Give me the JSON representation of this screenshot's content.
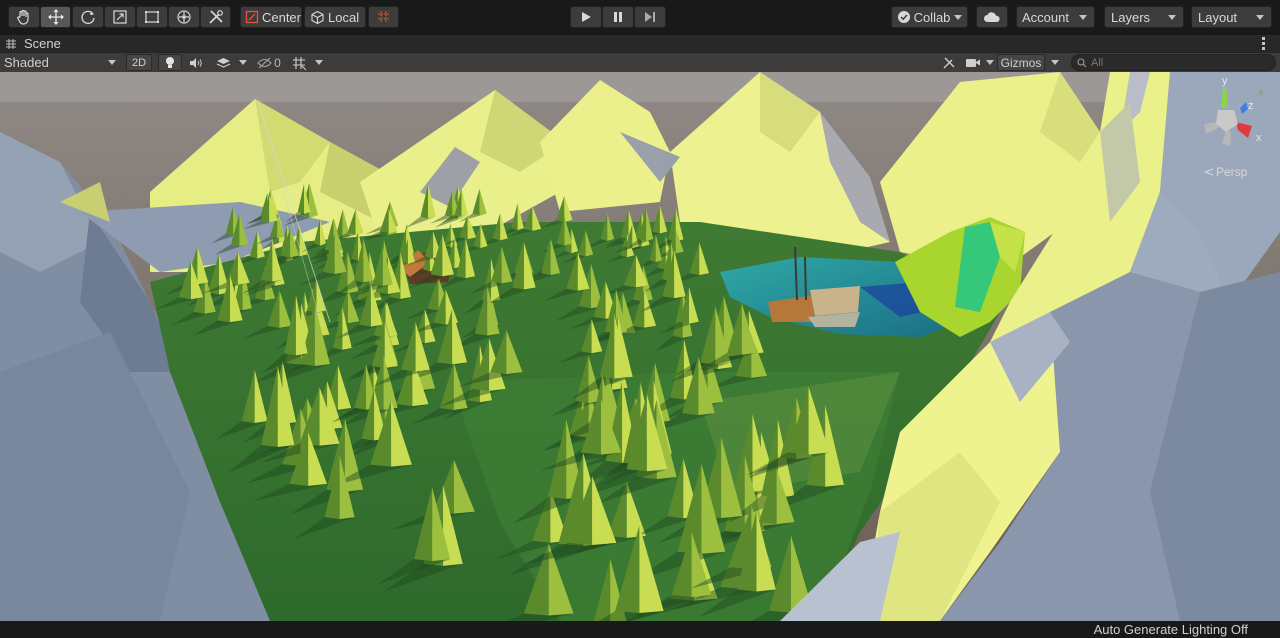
{
  "toolbar": {
    "tools": [
      {
        "name": "hand-tool",
        "icon": "hand-icon"
      },
      {
        "name": "move-tool",
        "icon": "move-arrows-icon"
      },
      {
        "name": "rotate-tool",
        "icon": "rotate-icon"
      },
      {
        "name": "scale-tool",
        "icon": "scale-icon"
      },
      {
        "name": "rect-tool",
        "icon": "rect-icon"
      },
      {
        "name": "transform-tool",
        "icon": "transform-icon"
      },
      {
        "name": "custom-tool",
        "icon": "tools-icon"
      }
    ],
    "pivot_label": "Center",
    "space_label": "Local",
    "collab_label": "Collab",
    "account_label": "Account",
    "layers_label": "Layers",
    "layout_label": "Layout",
    "accent_color": "#e6553b"
  },
  "tab": {
    "label": "Scene",
    "menu_icon": "kebab-menu-icon"
  },
  "scene_toolbar": {
    "draw_mode": "Shaded",
    "mode_2d_label": "2D",
    "hidden_count": "0",
    "gizmos_label": "Gizmos",
    "search_placeholder": "All"
  },
  "viewport": {
    "projection_label": "Persp",
    "axis_labels": {
      "x": "x",
      "y": "y",
      "z": "z"
    },
    "axis_colors": {
      "x": "#e03b3b",
      "y": "#8ed14a",
      "z": "#3e7ee0"
    }
  },
  "status": {
    "text": "Auto Generate Lighting Off"
  }
}
